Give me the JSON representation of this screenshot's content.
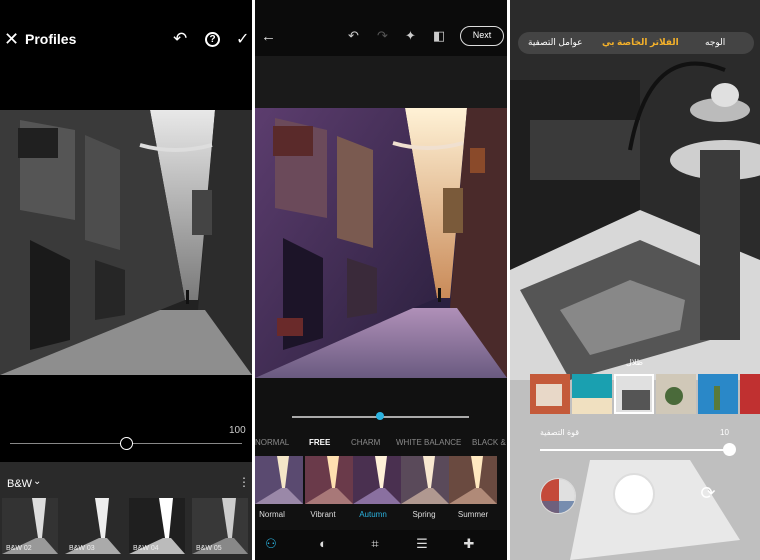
{
  "left_panel": {
    "title": "Profiles",
    "slider_value": "100",
    "profile_group": "B&W",
    "thumbnails": [
      "B&W 02",
      "B&W 03",
      "B&W 04",
      "B&W 05"
    ],
    "icons": [
      "close-icon",
      "undo-icon",
      "help-icon",
      "check-icon",
      "chevron-down-icon",
      "more-vertical-icon"
    ]
  },
  "middle_panel": {
    "next_button": "Next",
    "filter_tabs": [
      "NORMAL",
      "FREE",
      "CHARM",
      "WHITE BALANCE",
      "BLACK & W"
    ],
    "active_tab": "FREE",
    "filters": [
      "Normal",
      "Vibrant",
      "Autumn",
      "Spring",
      "Summer"
    ],
    "selected_filter": "Autumn",
    "accent": "#2bb3e0",
    "icons": [
      "back-icon",
      "undo-icon",
      "redo-icon",
      "magic-wand-icon",
      "compare-icon",
      "filters-icon",
      "beta-effects-icon",
      "crop-icon",
      "adjust-icon",
      "heal-icon"
    ]
  },
  "right_panel": {
    "tabs": [
      "الوجه",
      "الفلاتر الخاصة بي",
      "عوامل التصفية"
    ],
    "active_tab": "الفلاتر الخاصة بي",
    "accent": "#f3b02a",
    "filter_caption": "ظلال",
    "strength_label": "قوة التصفية",
    "strength_value": "10",
    "icons": [
      "shutter-button",
      "flip-camera-icon",
      "filter-preview-icon"
    ]
  }
}
